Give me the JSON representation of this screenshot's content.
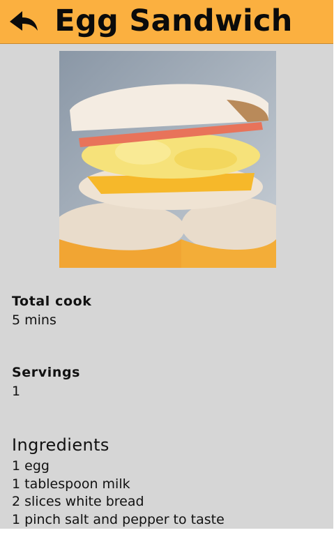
{
  "header": {
    "title": "Egg Sandwich",
    "back_icon": "back-arrow-icon",
    "background_color": "#fbb040"
  },
  "recipe": {
    "image_alt": "Egg sandwich on English muffins",
    "total_cook_label": "Total cook",
    "total_cook_value": "5 mins",
    "servings_label": "Servings",
    "servings_value": "1",
    "ingredients_label": "Ingredients",
    "ingredients": [
      "1 egg",
      "1 tablespoon milk",
      "2 slices white bread",
      "1 pinch salt and pepper to taste"
    ]
  },
  "colors": {
    "page_background": "#d6d6d6",
    "text": "#111111"
  }
}
